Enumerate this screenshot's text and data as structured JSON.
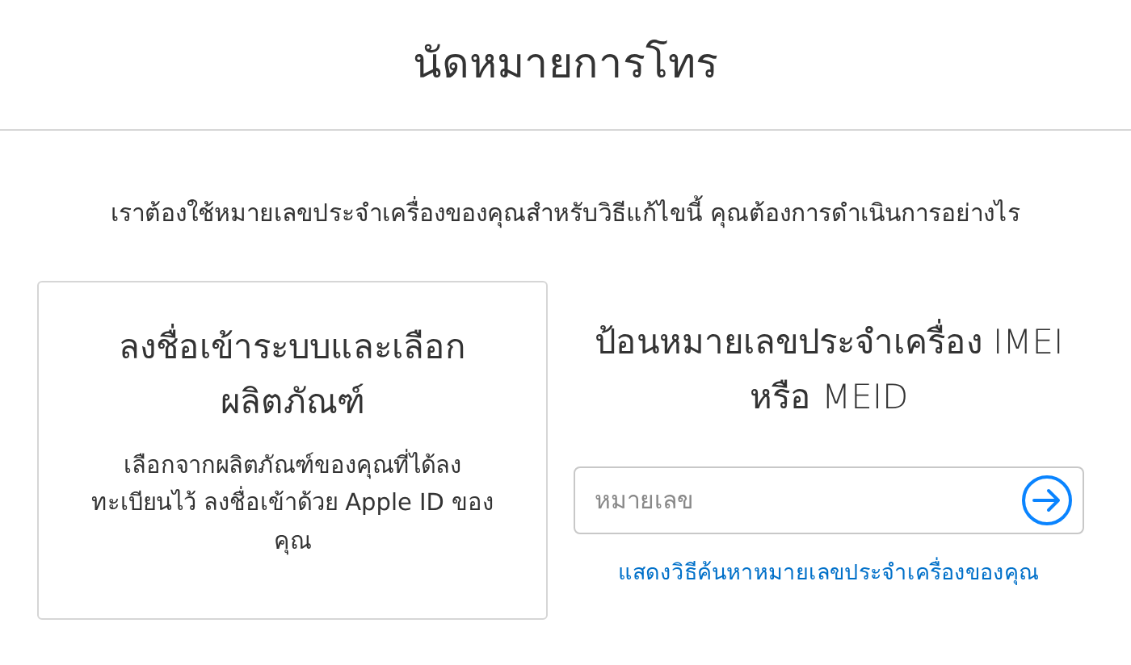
{
  "header": {
    "title": "นัดหมายการโทร"
  },
  "intro": "เราต้องใช้หมายเลขประจำเครื่องของคุณสำหรับวิธีแก้ไขนี้ คุณต้องการดำเนินการอย่างไร",
  "sign_in_option": {
    "title": "ลงชื่อเข้าระบบและเลือกผลิตภัณฑ์",
    "description": "เลือกจากผลิตภัณฑ์ของคุณที่ได้ลงทะเบียนไว้ ลงชื่อเข้าด้วย Apple ID ของคุณ"
  },
  "serial_option": {
    "title": "ป้อนหมายเลขประจำเครื่อง IMEI หรือ MEID",
    "field": {
      "placeholder": "หมายเลข"
    },
    "link": "แสดงวิธีค้นหาหมายเลขประจำเครื่องของคุณ"
  }
}
